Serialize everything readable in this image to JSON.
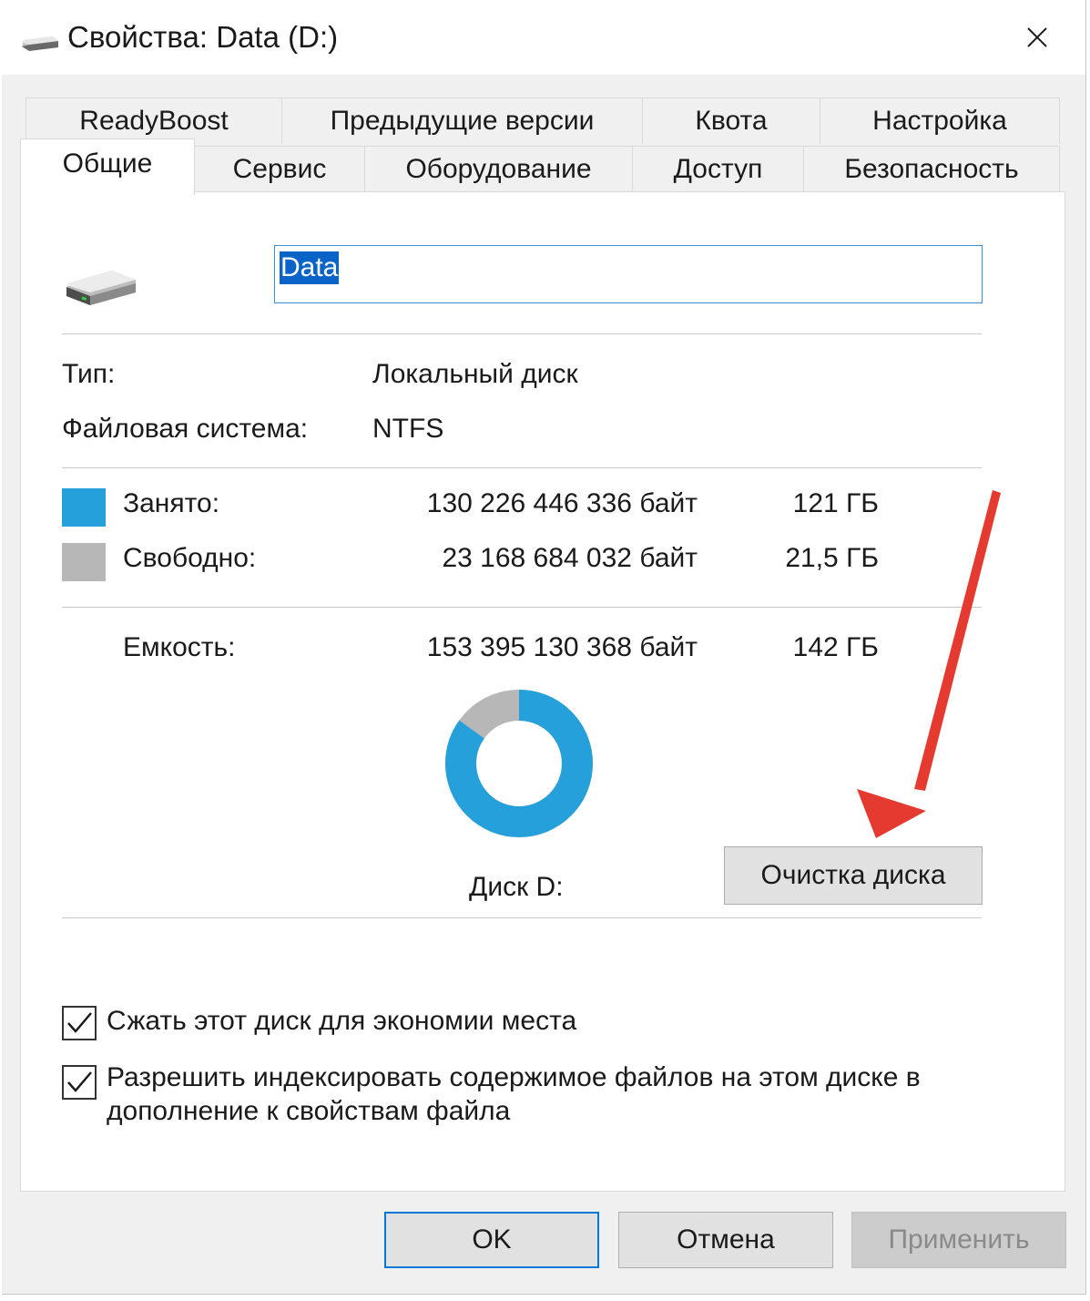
{
  "window": {
    "title": "Свойства: Data (D:)",
    "close_symbol": "✕"
  },
  "tabs_top": [
    "ReadyBoost",
    "Предыдущие версии",
    "Квота",
    "Настройка"
  ],
  "tabs_bottom": [
    "Общие",
    "Сервис",
    "Оборудование",
    "Доступ",
    "Безопасность"
  ],
  "active_tab": "Общие",
  "drive": {
    "name_value": "Data",
    "type_label": "Тип:",
    "type_value": "Локальный диск",
    "fs_label": "Файловая система:",
    "fs_value": "NTFS"
  },
  "usage": {
    "used_label": "Занято:",
    "used_bytes": "130 226 446 336 байт",
    "used_gb": "121 ГБ",
    "free_label": "Свободно:",
    "free_bytes": "23 168 684 032 байт",
    "free_gb": "21,5 ГБ",
    "capacity_label": "Емкость:",
    "capacity_bytes": "153 395 130 368 байт",
    "capacity_gb": "142 ГБ",
    "used_fraction": 0.849,
    "used_color": "#26a0da",
    "free_color": "#b7b7b7",
    "disk_label": "Диск D:",
    "cleanup_button": "Очистка диска"
  },
  "options": {
    "compress_label": "Сжать этот диск для экономии места",
    "compress_checked": true,
    "index_label_line1": "Разрешить индексировать содержимое файлов на этом диске в",
    "index_label_line2": "дополнение к свойствам файла",
    "index_checked": true
  },
  "footer": {
    "ok": "OK",
    "cancel": "Отмена",
    "apply": "Применить"
  },
  "annotation": {
    "arrow_color": "#e53a2f"
  }
}
